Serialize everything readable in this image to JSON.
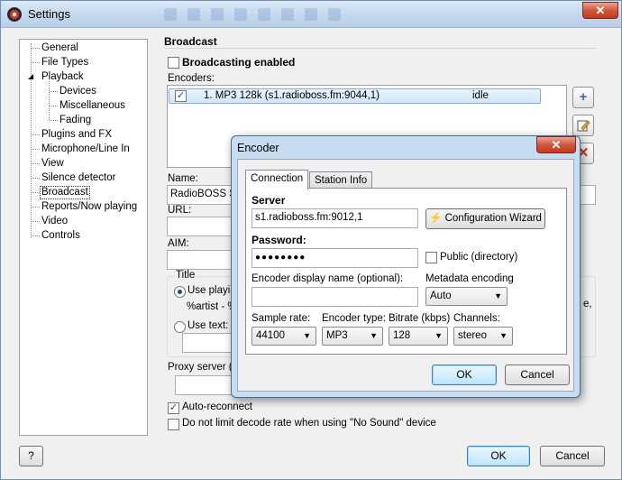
{
  "window": {
    "title": "Settings",
    "close_glyph": "✕"
  },
  "tree": {
    "items": [
      {
        "label": "General",
        "level": 0
      },
      {
        "label": "File Types",
        "level": 0
      },
      {
        "label": "Playback",
        "level": 0
      },
      {
        "label": "Devices",
        "level": 1
      },
      {
        "label": "Miscellaneous",
        "level": 1
      },
      {
        "label": "Fading",
        "level": 1
      },
      {
        "label": "Plugins and FX",
        "level": 0
      },
      {
        "label": "Microphone/Line In",
        "level": 0
      },
      {
        "label": "View",
        "level": 0
      },
      {
        "label": "Silence detector",
        "level": 0
      },
      {
        "label": "Broadcast",
        "level": 0,
        "selected": true
      },
      {
        "label": "Reports/Now playing",
        "level": 0
      },
      {
        "label": "Video",
        "level": 0
      },
      {
        "label": "Controls",
        "level": 0
      }
    ],
    "expand_glyph": "◢"
  },
  "broadcast": {
    "title": "Broadcast",
    "enabled_label": "Broadcasting enabled",
    "encoders_label": "Encoders:",
    "encoder_row": {
      "name": "1. MP3 128k (s1.radioboss.fm:9044,1)",
      "status": "idle",
      "checked": true
    },
    "name_label": "Name:",
    "name_value": "RadioBOSS St",
    "url_label": "URL:",
    "aim_label": "AIM:",
    "title_group": "Title",
    "use_playing_label": "Use playin",
    "title_template": "%artist - %",
    "use_text_label": "Use text:",
    "proxy_label": "Proxy server (",
    "auto_reconnect_label": "Auto-reconnect",
    "no_limit_label": "Do not limit decode rate when using \"No Sound\" device",
    "right_cut_text": "e,"
  },
  "footer": {
    "help_label": "?",
    "ok_label": "OK",
    "cancel_label": "Cancel"
  },
  "encoder_dialog": {
    "title": "Encoder",
    "close_glyph": "✕",
    "tabs": [
      "Connection",
      "Station Info"
    ],
    "server_label": "Server",
    "server_value": "s1.radioboss.fm:9012,1",
    "wizard_label": "Configuration Wizard",
    "password_label": "Password:",
    "password_value": "●●●●●●●●",
    "public_label": "Public (directory)",
    "display_name_label": "Encoder display name (optional):",
    "display_name_value": "",
    "metadata_label": "Metadata encoding",
    "metadata_value": "Auto",
    "sample_rate_label": "Sample rate:",
    "sample_rate_value": "44100",
    "encoder_type_label": "Encoder type:",
    "encoder_type_value": "MP3",
    "bitrate_label": "Bitrate (kbps)",
    "bitrate_value": "128",
    "channels_label": "Channels:",
    "channels_value": "stereo",
    "ok_label": "OK",
    "cancel_label": "Cancel"
  },
  "colors": {
    "accent": "#3c7fb1",
    "selection": "#d3e6f8",
    "title_bar": "#c6d9ee",
    "close_red": "#c23a1e"
  }
}
